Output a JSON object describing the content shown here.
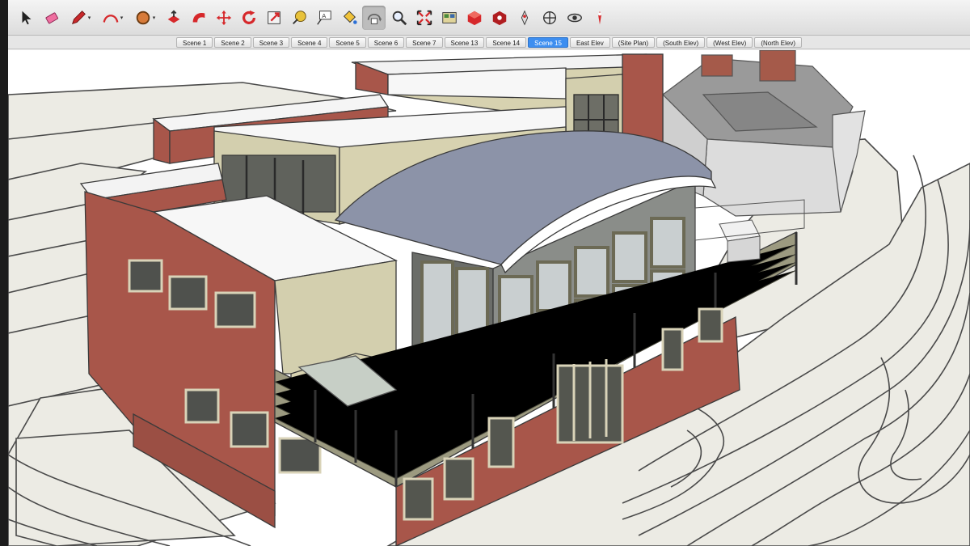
{
  "toolbar": {
    "tools": [
      {
        "name": "select-tool-icon",
        "glyph": "arrow"
      },
      {
        "name": "eraser-tool-icon",
        "glyph": "eraser"
      },
      {
        "name": "pencil-line-tool-icon",
        "glyph": "pencil",
        "dropdown": true
      },
      {
        "name": "arc-tool-icon",
        "glyph": "arc",
        "dropdown": true
      },
      {
        "name": "shapes-tool-icon",
        "glyph": "circle",
        "dropdown": true
      },
      {
        "name": "push-pull-tool-icon",
        "glyph": "pushpull"
      },
      {
        "name": "follow-me-tool-icon",
        "glyph": "followme"
      },
      {
        "name": "move-tool-icon",
        "glyph": "move"
      },
      {
        "name": "rotate-tool-icon",
        "glyph": "rotate"
      },
      {
        "name": "scale-tool-icon",
        "glyph": "scale"
      },
      {
        "name": "tape-measure-tool-icon",
        "glyph": "tape"
      },
      {
        "name": "text-tool-icon",
        "glyph": "text"
      },
      {
        "name": "paint-bucket-tool-icon",
        "glyph": "bucket"
      },
      {
        "name": "orbit-tool-icon",
        "glyph": "orbit",
        "active": true
      },
      {
        "name": "zoom-tool-icon",
        "glyph": "zoom"
      },
      {
        "name": "zoom-extents-tool-icon",
        "glyph": "extents"
      },
      {
        "name": "layer-manager-icon",
        "glyph": "layers"
      },
      {
        "name": "3d-warehouse-icon",
        "glyph": "warehouse"
      },
      {
        "name": "extension-warehouse-icon",
        "glyph": "extension"
      },
      {
        "name": "position-camera-tool-icon",
        "glyph": "camera"
      },
      {
        "name": "walk-tool-icon",
        "glyph": "walk"
      },
      {
        "name": "look-around-tool-icon",
        "glyph": "eye"
      },
      {
        "name": "section-plane-tool-icon",
        "glyph": "section"
      }
    ]
  },
  "scenes": {
    "tabs": [
      {
        "label": "Scene 1"
      },
      {
        "label": "Scene 2"
      },
      {
        "label": "Scene 3"
      },
      {
        "label": "Scene 4"
      },
      {
        "label": "Scene 5"
      },
      {
        "label": "Scene 6"
      },
      {
        "label": "Scene 7"
      },
      {
        "label": "Scene 13"
      },
      {
        "label": "Scene 14"
      },
      {
        "label": "Scene 15",
        "active": true
      },
      {
        "label": "East Elev"
      },
      {
        "label": "(Site Plan)"
      },
      {
        "label": "(South Elev)"
      },
      {
        "label": "(West Elev)"
      },
      {
        "label": "(North Elev)"
      }
    ]
  },
  "colors": {
    "brick": "#a8564a",
    "siding": "#d3cfae",
    "roof_flat": "#f7f7f7",
    "roof_curved": "#8c93a8",
    "terrain": "#ecebe4",
    "active_tab": "#3d8ef0",
    "red_icon": "#d6282b"
  }
}
